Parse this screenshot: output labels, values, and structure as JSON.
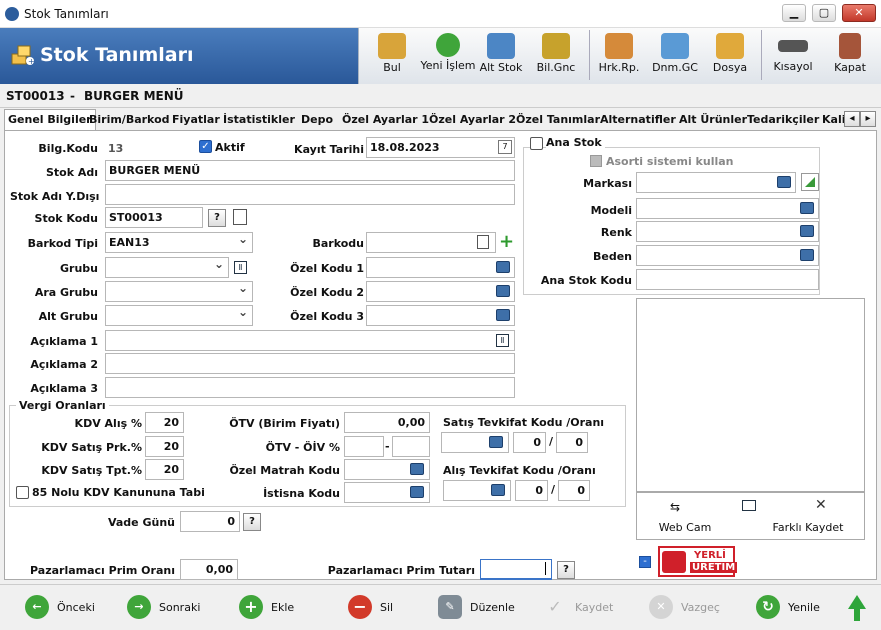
{
  "window": {
    "title": "Stok Tanımları",
    "min": "▁",
    "max": "▢",
    "close": "✕"
  },
  "header": {
    "title": "Stok Tanımları"
  },
  "toolbar": [
    {
      "label": "Bul",
      "icon": "search-icon",
      "color": "#d8a43a"
    },
    {
      "label": "Yeni İşlem",
      "icon": "add-icon",
      "color": "#3fa53a"
    },
    {
      "label": "Alt Stok",
      "icon": "network-icon",
      "color": "#4c86c5"
    },
    {
      "label": "Bil.Gnc",
      "icon": "coins-icon",
      "color": "#c7a22c"
    },
    {
      "label": "Hrk.Rp.",
      "icon": "report-icon",
      "color": "#d58a3a"
    },
    {
      "label": "Dnm.GC",
      "icon": "document-icon",
      "color": "#5a9ad5"
    },
    {
      "label": "Dosya",
      "icon": "folder-icon",
      "color": "#e0a93b"
    },
    {
      "label": "Kısayol",
      "icon": "keyboard-icon",
      "color": "#555555"
    },
    {
      "label": "Kapat",
      "icon": "exit-icon",
      "color": "#a5553a"
    }
  ],
  "record": {
    "code": "ST00013",
    "sep": "-",
    "name": "BURGER MENÜ"
  },
  "tabs": [
    "Genel Bilgiler",
    "Birim/Barkod",
    "Fiyatlar",
    "İstatistikler",
    "Depo",
    "Özel Ayarlar 1",
    "Özel Ayarlar 2",
    "Özel Tanımlar",
    "Alternatifler",
    "Alt Ürünler",
    "Tedarikçiler",
    "Kali"
  ],
  "form": {
    "bilg_kodu_label": "Bilg.Kodu",
    "bilg_kodu": "13",
    "aktif_label": "Aktif",
    "kayit_tarihi_label": "Kayıt Tarihi",
    "kayit_tarihi": "18.08.2023",
    "stok_adi_label": "Stok Adı",
    "stok_adi": "BURGER MENÜ",
    "stok_adi_yd_label": "Stok Adı Y.Dışı",
    "stok_adi_yd": "",
    "stok_kodu_label": "Stok Kodu",
    "stok_kodu": "ST00013",
    "barkod_tipi_label": "Barkod Tipi",
    "barkod_tipi": "EAN13",
    "barkodu_label": "Barkodu",
    "barkodu": "",
    "grubu_label": "Grubu",
    "ara_grubu_label": "Ara Grubu",
    "alt_grubu_label": "Alt Grubu",
    "ozel1_label": "Özel Kodu 1",
    "ozel2_label": "Özel Kodu 2",
    "ozel3_label": "Özel Kodu 3",
    "aciklama1_label": "Açıklama 1",
    "aciklama2_label": "Açıklama 2",
    "aciklama3_label": "Açıklama 3",
    "help": "?"
  },
  "right": {
    "ana_stok_label": "Ana Stok",
    "asorti_label": "Asorti sistemi kullan",
    "markasi_label": "Markası",
    "modeli_label": "Modeli",
    "renk_label": "Renk",
    "beden_label": "Beden",
    "ana_stok_kodu_label": "Ana Stok Kodu",
    "webcam_label": "Web Cam",
    "farkli_kaydet_label": "Farklı Kaydet",
    "badge_line1": "YERLİ",
    "badge_line2": "ÜRETİM"
  },
  "vergi": {
    "title": "Vergi Oranları",
    "kdv_alis_label": "KDV Alış %",
    "kdv_alis": "20",
    "kdv_satis_prk_label": "KDV Satış Prk.%",
    "kdv_satis_prk": "20",
    "kdv_satis_tpt_label": "KDV Satış Tpt.%",
    "kdv_satis_tpt": "20",
    "kanun_label": "85 Nolu KDV Kanununa Tabi",
    "otv_birim_label": "ÖTV (Birim Fiyatı)",
    "otv_birim": "0,00",
    "otv_oiv_label": "ÖTV - ÖİV %",
    "dash": "-",
    "ozel_matrah_label": "Özel Matrah Kodu",
    "istisna_label": "İstisna Kodu",
    "satis_tevk_label": "Satış Tevkifat Kodu /Oranı",
    "satis_tevk_a": "0",
    "satis_tevk_b": "0",
    "alis_tevk_label": "Alış Tevkifat Kodu /Oranı",
    "alis_tevk_a": "0",
    "alis_tevk_b": "0",
    "slash": "/"
  },
  "extra": {
    "vade_label": "Vade Günü",
    "vade": "0",
    "prim_orani_label": "Pazarlamacı Prim Oranı",
    "prim_orani": "0,00",
    "prim_tutari_label": "Pazarlamacı Prim Tutarı",
    "prim_tutari": ""
  },
  "bottom": [
    {
      "label": "Önceki",
      "color": "#3fa53a",
      "icon": "←"
    },
    {
      "label": "Sonraki",
      "color": "#3fa53a",
      "icon": "→"
    },
    {
      "label": "Ekle",
      "color": "#3fa53a",
      "icon": "+"
    },
    {
      "label": "Sil",
      "color": "#d23a2a",
      "icon": "−"
    },
    {
      "label": "Düzenle",
      "color": "#7f8b95",
      "icon": "✎"
    },
    {
      "label": "Kaydet",
      "color": "#c8c8c8",
      "icon": "✓"
    },
    {
      "label": "Vazgeç",
      "color": "#c8c8c8",
      "icon": "✕"
    },
    {
      "label": "Yenile",
      "color": "#3fa53a",
      "icon": "↻"
    }
  ]
}
